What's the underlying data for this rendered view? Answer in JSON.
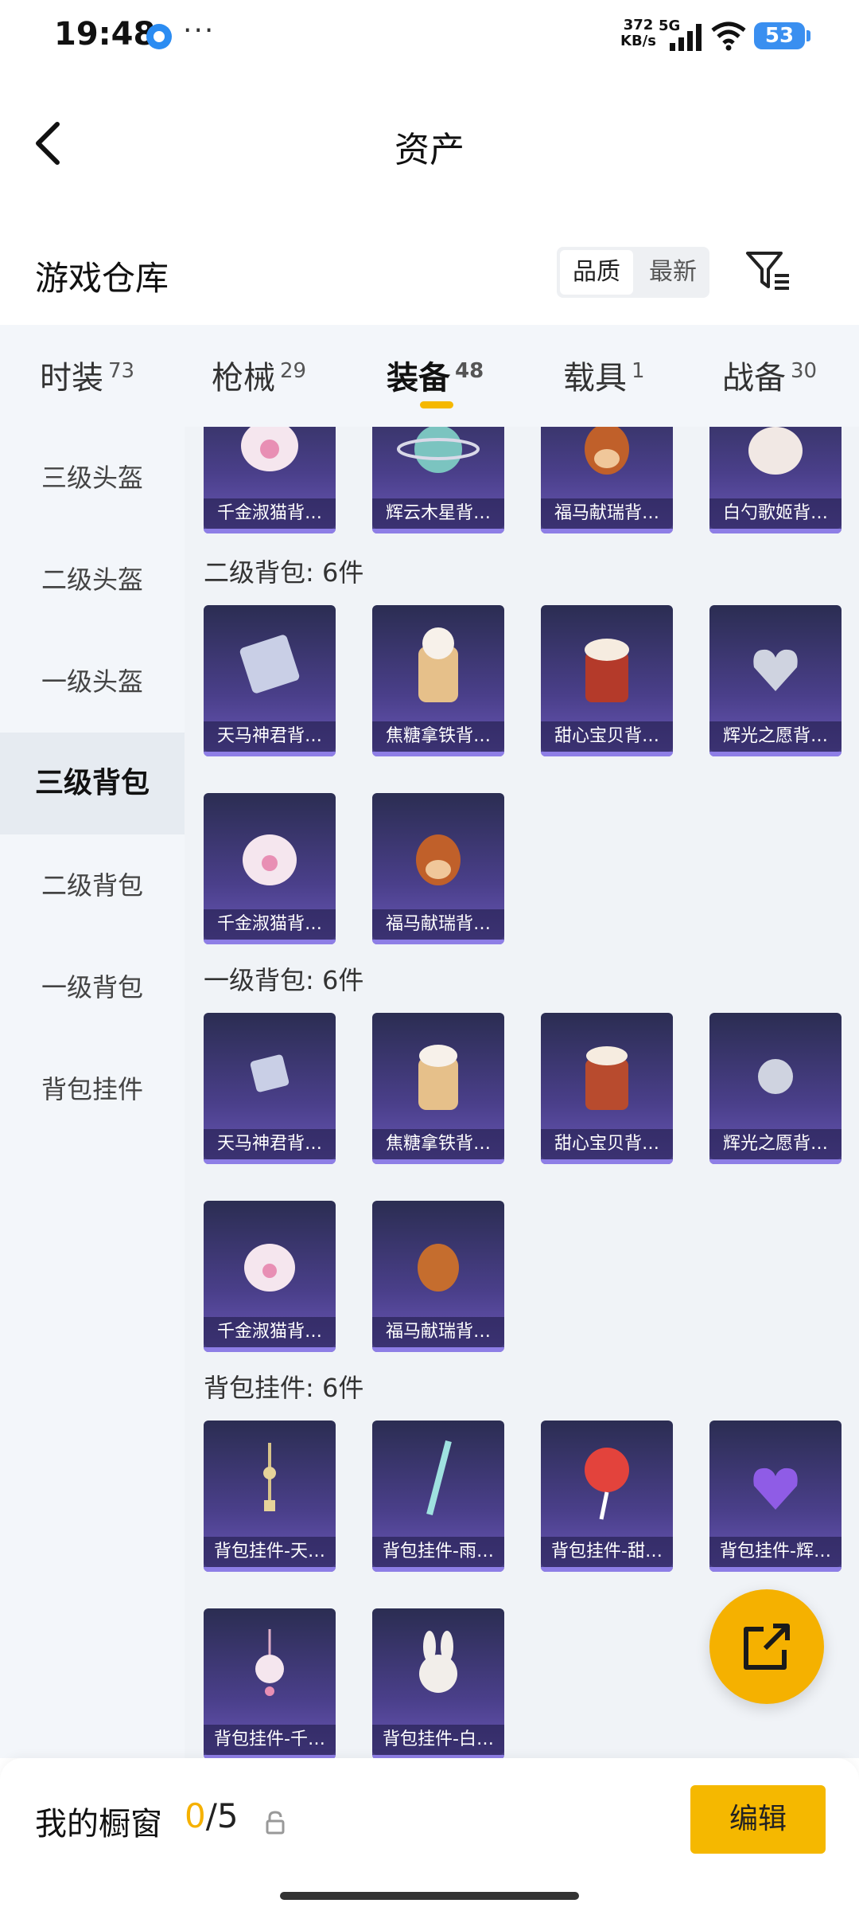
{
  "status_bar": {
    "time": "19:48",
    "more": "···",
    "net_speed_value": "372",
    "net_speed_unit": "KB/s",
    "network": "5G",
    "battery": "53"
  },
  "nav": {
    "title": "资产"
  },
  "header": {
    "title": "游戏仓库",
    "sort_options": [
      "品质",
      "最新"
    ]
  },
  "tabs": [
    {
      "label": "时装",
      "count": "73"
    },
    {
      "label": "枪械",
      "count": "29"
    },
    {
      "label": "装备",
      "count": "48"
    },
    {
      "label": "载具",
      "count": "1"
    },
    {
      "label": "战备",
      "count": "30"
    }
  ],
  "sidebar": [
    "三级头盔",
    "二级头盔",
    "一级头盔",
    "三级背包",
    "二级背包",
    "一级背包",
    "背包挂件"
  ],
  "top_row": [
    "千金淑猫背…",
    "辉云木星背…",
    "福马献瑞背…",
    "白勺歌姬背…"
  ],
  "sections": [
    {
      "title": "二级背包: 6件",
      "items": [
        "天马神君背…",
        "焦糖拿铁背…",
        "甜心宝贝背…",
        "辉光之愿背…",
        "千金淑猫背…",
        "福马献瑞背…"
      ]
    },
    {
      "title": "一级背包: 6件",
      "items": [
        "天马神君背…",
        "焦糖拿铁背…",
        "甜心宝贝背…",
        "辉光之愿背…",
        "千金淑猫背…",
        "福马献瑞背…"
      ]
    },
    {
      "title": "背包挂件: 6件",
      "items": [
        "背包挂件-天…",
        "背包挂件-雨…",
        "背包挂件-甜…",
        "背包挂件-辉…",
        "背包挂件-千…",
        "背包挂件-白…"
      ]
    }
  ],
  "bottom_bar": {
    "label": "我的橱窗",
    "count_current": "0",
    "count_total": "/5",
    "edit_label": "编辑"
  },
  "colors": {
    "accent": "#f5b800",
    "card_top": "#2b2d52",
    "card_bottom": "#6a58b8"
  }
}
